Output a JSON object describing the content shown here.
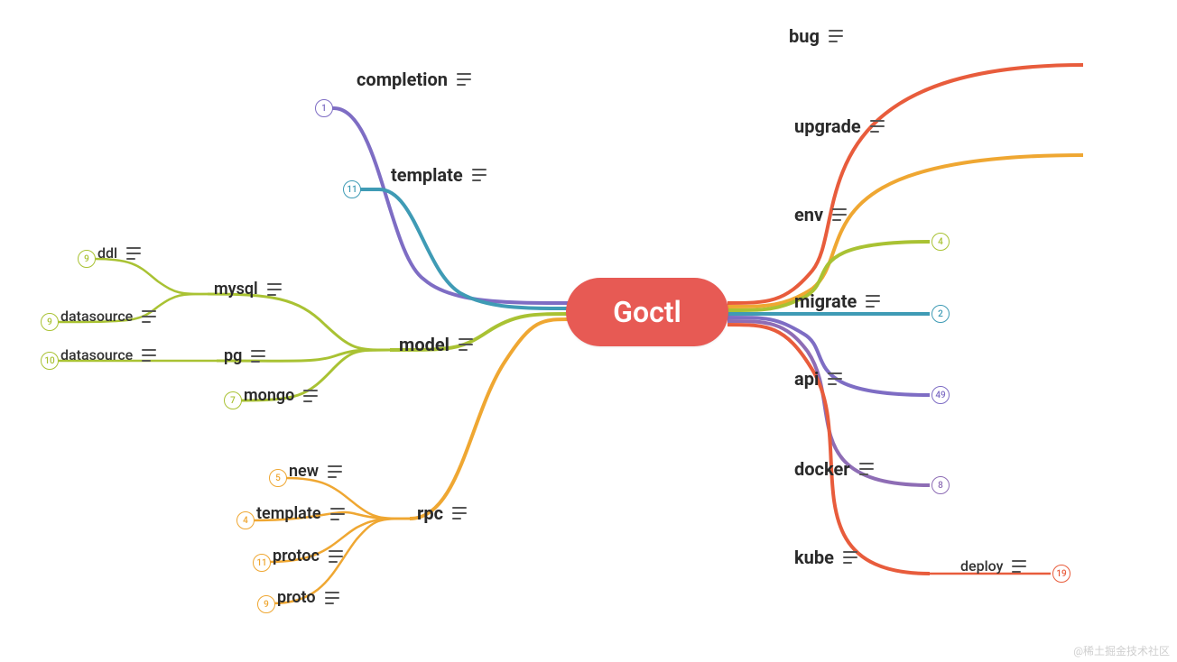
{
  "center": {
    "label": "Goctl"
  },
  "left": {
    "completion": {
      "label": "completion",
      "badge": "1"
    },
    "template": {
      "label": "template",
      "badge": "11"
    },
    "model": {
      "label": "model",
      "children": {
        "mysql": {
          "label": "mysql",
          "children": {
            "ddl": {
              "label": "ddl",
              "badge": "9"
            },
            "datasource": {
              "label": "datasource",
              "badge": "9"
            }
          }
        },
        "pg": {
          "label": "pg",
          "children": {
            "datasource": {
              "label": "datasource",
              "badge": "10"
            }
          }
        },
        "mongo": {
          "label": "mongo",
          "badge": "7"
        }
      }
    },
    "rpc": {
      "label": "rpc",
      "children": {
        "new": {
          "label": "new",
          "badge": "5"
        },
        "template": {
          "label": "template",
          "badge": "4"
        },
        "protoc": {
          "label": "protoc",
          "badge": "11"
        },
        "proto": {
          "label": "proto",
          "badge": "9"
        }
      }
    }
  },
  "right": {
    "bug": {
      "label": "bug"
    },
    "upgrade": {
      "label": "upgrade"
    },
    "env": {
      "label": "env",
      "badge": "4"
    },
    "migrate": {
      "label": "migrate",
      "badge": "2"
    },
    "api": {
      "label": "api",
      "badge": "49"
    },
    "docker": {
      "label": "docker",
      "badge": "8"
    },
    "kube": {
      "label": "kube",
      "children": {
        "deploy": {
          "label": "deploy",
          "badge": "19"
        }
      }
    }
  },
  "colors": {
    "completion": "#7E6DC4",
    "template_l": "#3F9BB5",
    "model": "#A9C233",
    "rpc": "#EFA732",
    "bug": "#E85C3C",
    "upgrade": "#EFA732",
    "env": "#A9C233",
    "migrate": "#3F9BB5",
    "api": "#7E6DC4",
    "docker": "#8E6DB5",
    "kube": "#E85C3C"
  },
  "watermark": "@稀土掘金技术社区"
}
